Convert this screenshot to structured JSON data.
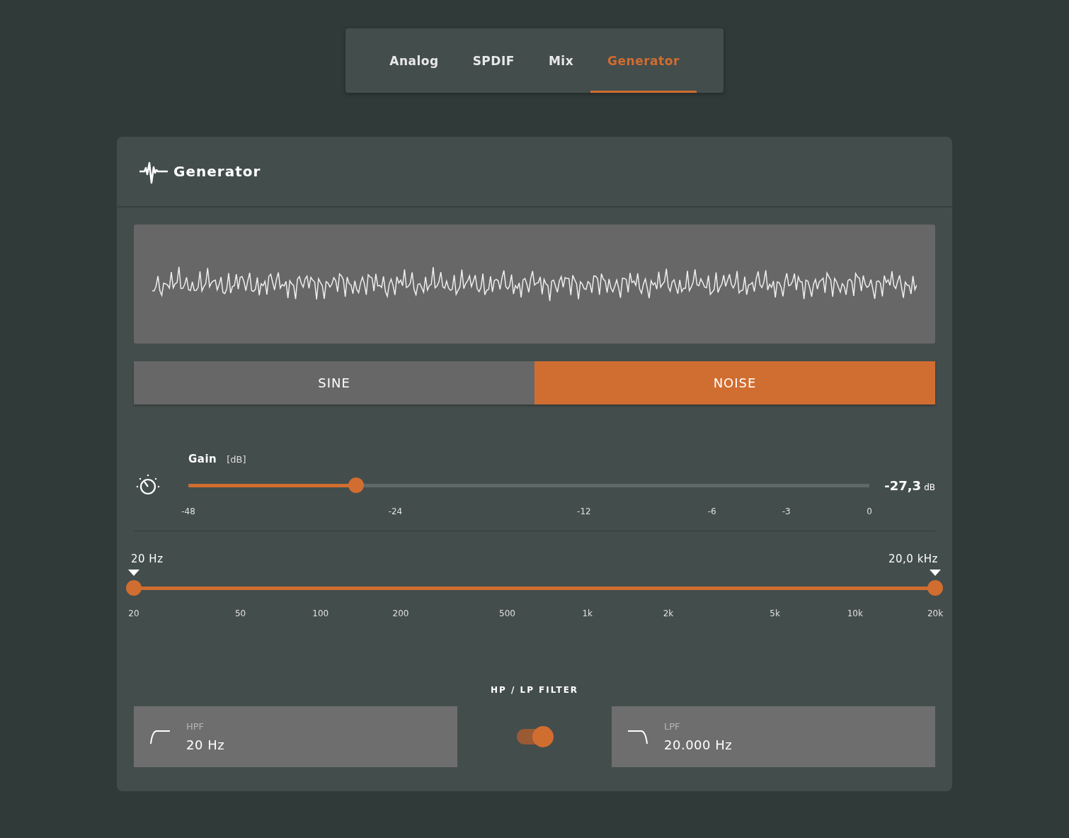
{
  "tabs": [
    {
      "label": "Analog",
      "selected": false
    },
    {
      "label": "SPDIF",
      "selected": false
    },
    {
      "label": "Mix",
      "selected": false
    },
    {
      "label": "Generator",
      "selected": true
    }
  ],
  "panel": {
    "title": "Generator",
    "modes": [
      {
        "label": "SINE",
        "selected": false
      },
      {
        "label": "NOISE",
        "selected": true
      }
    ],
    "gain": {
      "label": "Gain",
      "unit": "[dB]",
      "level": 0.246,
      "reading": "-27,3",
      "reading_unit": "dB",
      "ticks": [
        "-48",
        "-24",
        "-12",
        "-6",
        "-3",
        "0"
      ]
    },
    "range": {
      "low_reading": "20 Hz",
      "high_reading": "20,0 kHz",
      "low": {
        "level": 0
      },
      "high": {
        "level": 1
      },
      "ticks": [
        "20",
        "50",
        "100",
        "200",
        "500",
        "1k",
        "2k",
        "5k",
        "10k",
        "20k"
      ]
    },
    "filter": {
      "title": "HP / LP FILTER",
      "on": true,
      "hpf": {
        "label": "HPF",
        "value": "20 Hz"
      },
      "lpf": {
        "label": "LPF",
        "value": "20.000 Hz"
      }
    }
  }
}
